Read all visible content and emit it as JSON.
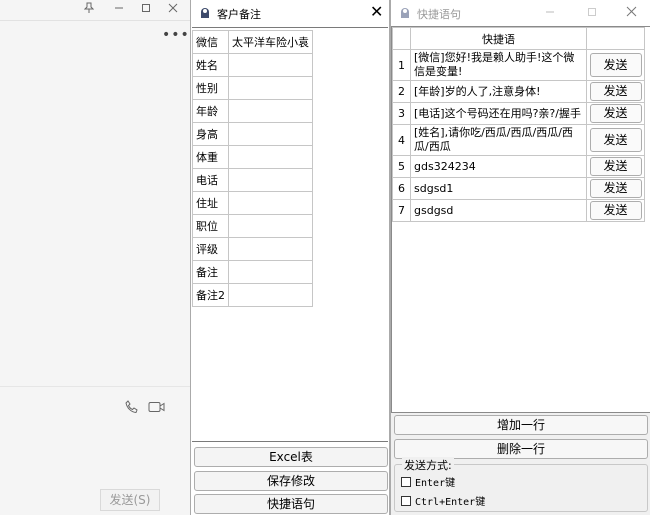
{
  "chat_window": {
    "send_button": "发送(S)"
  },
  "note_window": {
    "title": "客户备注",
    "close_glyph": "✕",
    "rows": [
      {
        "key": "微信",
        "value": "太平洋车险小袁"
      },
      {
        "key": "姓名",
        "value": ""
      },
      {
        "key": "性别",
        "value": ""
      },
      {
        "key": "年龄",
        "value": ""
      },
      {
        "key": "身高",
        "value": ""
      },
      {
        "key": "体重",
        "value": ""
      },
      {
        "key": "电话",
        "value": ""
      },
      {
        "key": "住址",
        "value": ""
      },
      {
        "key": "职位",
        "value": ""
      },
      {
        "key": "评级",
        "value": ""
      },
      {
        "key": "备注",
        "value": ""
      },
      {
        "key": "备注2",
        "value": ""
      }
    ],
    "buttons": {
      "excel": "Excel表",
      "save": "保存修改",
      "quick": "快捷语句"
    }
  },
  "quick_window": {
    "title": "快捷语句",
    "header": "快捷语",
    "send_label": "发送",
    "rows": [
      {
        "index": "1",
        "text": "[微信]您好!我是赖人助手!这个微信是变量!"
      },
      {
        "index": "2",
        "text": "[年龄]岁的人了,注意身体!"
      },
      {
        "index": "3",
        "text": "[电话]这个号码还在用吗?亲?/握手"
      },
      {
        "index": "4",
        "text": "[姓名],请你吃/西瓜/西瓜/西瓜/西瓜/西瓜"
      },
      {
        "index": "5",
        "text": "gds324234"
      },
      {
        "index": "6",
        "text": "sdgsd1"
      },
      {
        "index": "7",
        "text": "gsdgsd"
      }
    ],
    "add_row": "增加一行",
    "delete_row": "删除一行",
    "send_mode": {
      "legend": "发送方式:",
      "option_enter": "Enter键",
      "option_ctrl_enter": "Ctrl+Enter键"
    }
  },
  "icons": {
    "pin": "pin-icon",
    "minimize": "minimize-icon",
    "maximize": "maximize-icon",
    "close": "close-icon",
    "more": "more-icon",
    "phone": "phone-icon",
    "video": "video-icon",
    "app": "app-icon"
  },
  "colors": {
    "button_border": "#adadad",
    "disabled_text": "#9a9a9a",
    "window_bg": "#f0f0f0"
  }
}
